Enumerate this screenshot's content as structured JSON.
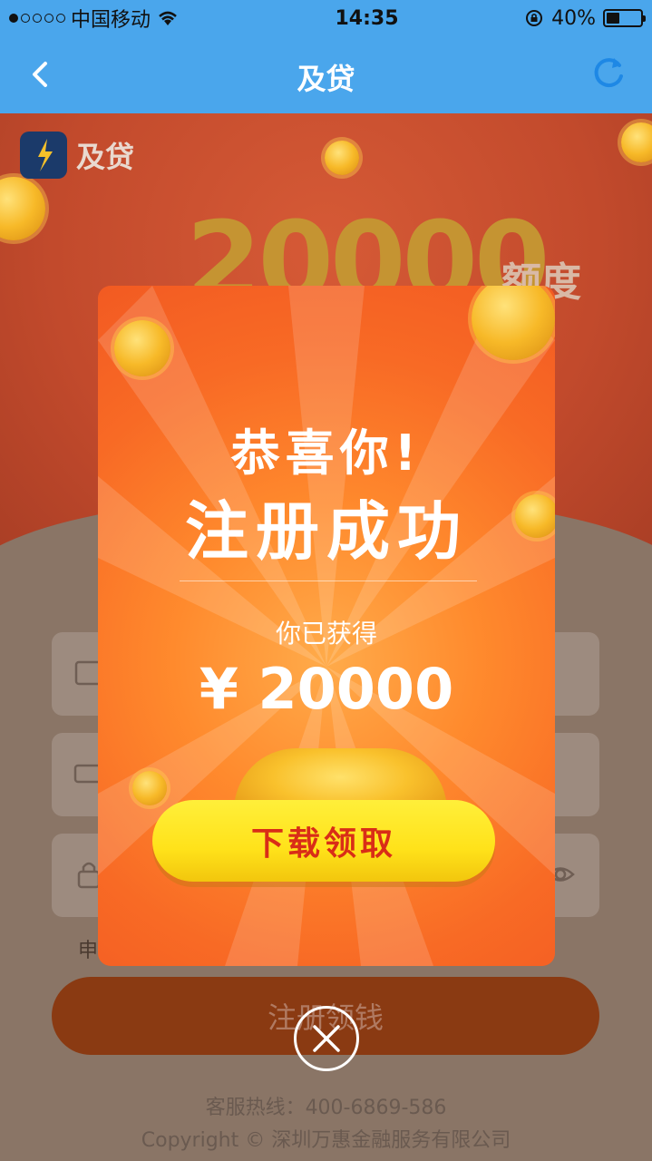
{
  "status_bar": {
    "carrier": "中国移动",
    "time": "14:35",
    "battery_text": "40%",
    "battery_level": 0.4
  },
  "nav": {
    "title": "及贷"
  },
  "background": {
    "brand_name": "及贷",
    "banner_amount": "20000",
    "banner_unit": "额度",
    "agreement_prefix": "申",
    "register_button": "注册领钱",
    "hotline": "客服热线：400-6869-586",
    "copyright": "Copyright © 深圳万惠金融服务有限公司"
  },
  "modal": {
    "title_line1": "恭喜你!",
    "title_line2": "注册成功",
    "subtitle": "你已获得",
    "amount": "¥ 20000",
    "download_button": "下载领取"
  },
  "colors": {
    "nav_blue": "#4aa6ec",
    "modal_orange": "#f86a25",
    "button_yellow": "#ffe21a",
    "button_text_red": "#d92d17"
  }
}
